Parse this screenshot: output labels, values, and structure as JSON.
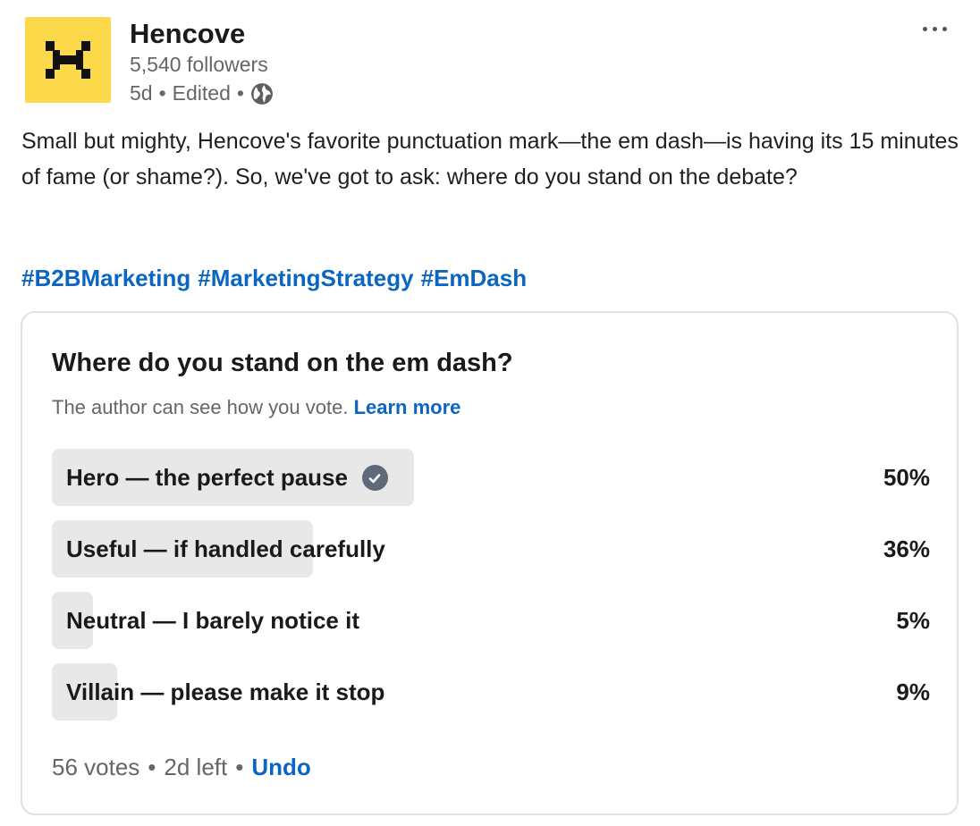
{
  "author": {
    "name": "Hencove",
    "followers": "5,540 followers",
    "age": "5d",
    "dot": "•",
    "edited": "Edited",
    "logo_icon": "hencove-h-logo",
    "logo_color": "#fcd94a",
    "visibility_icon": "globe-icon"
  },
  "post": {
    "text": "Small but mighty, Hencove's favorite punctuation mark—the em dash—is having its 15 minutes of fame (or shame?). So, we've got to ask: where do you stand on the debate?",
    "hashtags": [
      "#B2BMarketing",
      "#MarketingStrategy",
      "#EmDash"
    ]
  },
  "poll": {
    "question": "Where do you stand on the em dash?",
    "note": "The author can see how you vote.",
    "learn_more": "Learn more",
    "options": [
      {
        "label": "Hero — the perfect pause",
        "percent_label": "50%",
        "share": 0.5,
        "selected": true
      },
      {
        "label": "Useful — if handled carefully",
        "percent_label": "36%",
        "share": 0.36,
        "selected": false
      },
      {
        "label": "Neutral — I barely notice it",
        "percent_label": "5%",
        "share": 0.05,
        "selected": false
      },
      {
        "label": "Villain — please make it stop",
        "percent_label": "9%",
        "share": 0.09,
        "selected": false
      }
    ],
    "votes": "56 votes",
    "time_left": "2d left",
    "separator": "•",
    "undo": "Undo"
  },
  "colors": {
    "link": "#0a66c2",
    "bar_fill": "#e8e8e8",
    "check_badge": "#5e6a7a"
  }
}
